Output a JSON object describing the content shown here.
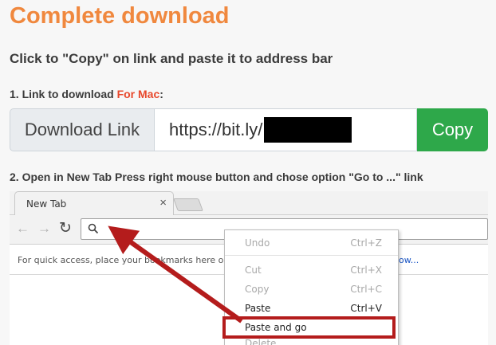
{
  "page": {
    "title": "Complete download",
    "subtitle": "Click to \"Copy\" on link and paste it to address bar",
    "step1_prefix": "1. Link to download ",
    "step1_highlight": "For Mac",
    "step1_suffix": ":",
    "step2": "2. Open in New Tab Press right mouse button and chose option \"Go to ...\" link"
  },
  "link_box": {
    "label": "Download Link",
    "url_value": "https://bit.ly/",
    "copy_label": "Copy"
  },
  "browser": {
    "tab_label": "New Tab",
    "tab_close": "×",
    "nav_back": "←",
    "nav_forward": "→",
    "nav_reload": "↻",
    "bookmarks_text": "For quick access, place your bookmarks here on t",
    "bookmarks_link": "ow..."
  },
  "context_menu": {
    "items": [
      {
        "label": "Undo",
        "shortcut": "Ctrl+Z",
        "state": "disabled"
      },
      {
        "label": "Cut",
        "shortcut": "Ctrl+X",
        "state": "disabled"
      },
      {
        "label": "Copy",
        "shortcut": "Ctrl+C",
        "state": "disabled"
      },
      {
        "label": "Paste",
        "shortcut": "Ctrl+V",
        "state": "enabled"
      },
      {
        "label": "Paste and go",
        "shortcut": "",
        "state": "enabled"
      },
      {
        "label": "Delete",
        "shortcut": "",
        "state": "disabled"
      }
    ]
  },
  "colors": {
    "title": "#f0883e",
    "accent_red": "#e8482c",
    "copy_button": "#2ea84a",
    "highlight_arrow": "#b41c1c"
  }
}
